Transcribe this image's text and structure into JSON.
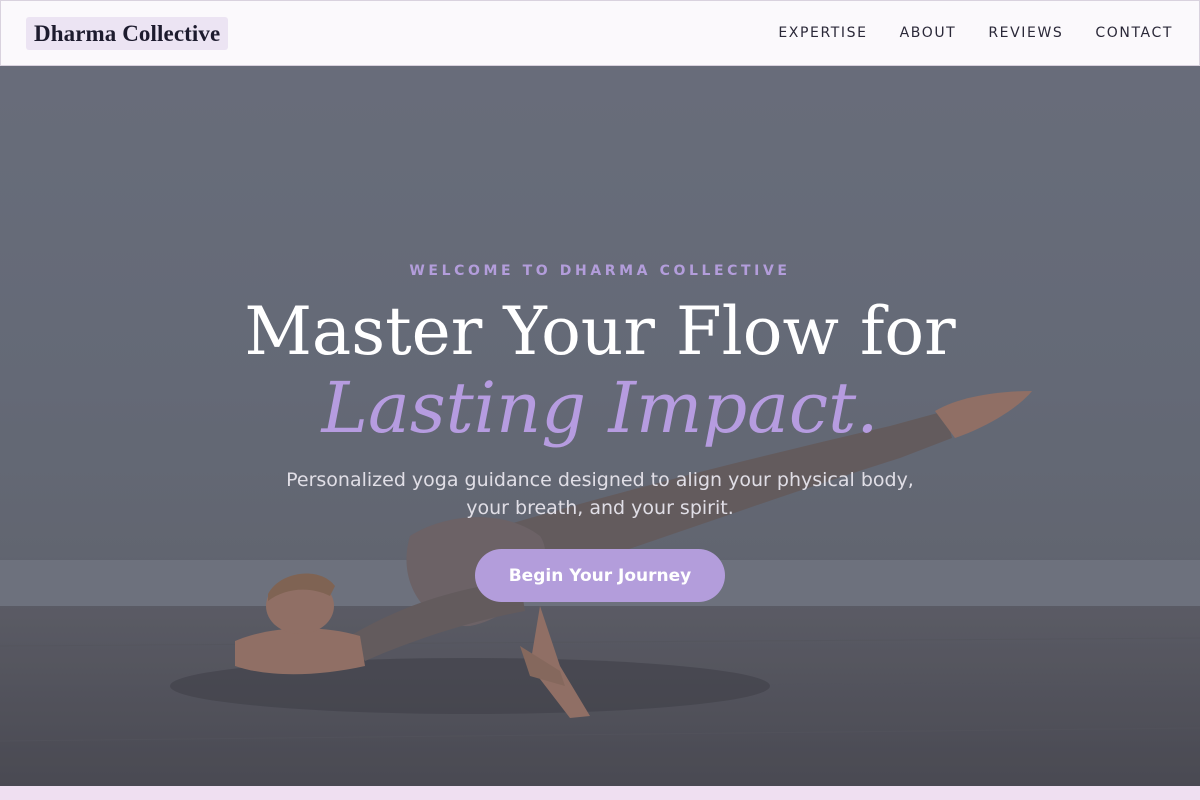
{
  "header": {
    "brand": "Dharma Collective",
    "nav": [
      {
        "label": "EXPERTISE"
      },
      {
        "label": "ABOUT"
      },
      {
        "label": "REVIEWS"
      },
      {
        "label": "CONTACT"
      }
    ]
  },
  "hero": {
    "eyebrow": "WELCOME TO DHARMA COLLECTIVE",
    "headline": "Master Your Flow for",
    "headline_accent": "Lasting Impact.",
    "subhead": "Personalized yoga guidance designed to align your physical body, your breath, and your spirit.",
    "cta_label": "Begin Your Journey",
    "image_icon": "yoga-arm-balance-photo"
  },
  "colors": {
    "accent": "#b39ddb",
    "header_bg": "#fbf9fc",
    "brand_bg": "#ece4f3",
    "text_dark": "#1d1b2e",
    "strip": "#efdff1"
  }
}
